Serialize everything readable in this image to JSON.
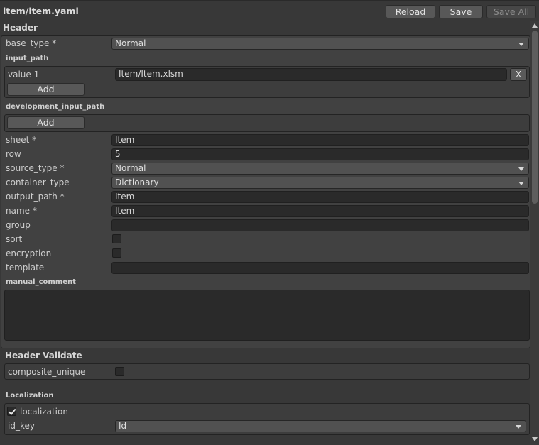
{
  "window": {
    "title": "item/item.yaml"
  },
  "toolbar": {
    "reload_label": "Reload",
    "save_label": "Save",
    "save_all_label": "Save All"
  },
  "header": {
    "title": "Header",
    "base_type": {
      "label": "base_type *",
      "value": "Normal"
    },
    "input_path": {
      "label": "input_path",
      "items": [
        {
          "label": "value 1",
          "value": "Item/Item.xlsm",
          "remove_label": "X"
        }
      ],
      "add_label": "Add"
    },
    "development_input_path": {
      "label": "development_input_path",
      "add_label": "Add"
    },
    "sheet": {
      "label": "sheet *",
      "value": "Item"
    },
    "row": {
      "label": "row",
      "value": "5"
    },
    "source_type": {
      "label": "source_type *",
      "value": "Normal"
    },
    "container_type": {
      "label": "container_type",
      "value": "Dictionary"
    },
    "output_path": {
      "label": "output_path *",
      "value": "Item"
    },
    "name": {
      "label": "name *",
      "value": "Item"
    },
    "group": {
      "label": "group",
      "value": ""
    },
    "sort": {
      "label": "sort",
      "checked": false
    },
    "encryption": {
      "label": "encryption",
      "checked": false
    },
    "template": {
      "label": "template",
      "value": ""
    },
    "manual_comment": {
      "label": "manual_comment",
      "value": ""
    }
  },
  "header_validate": {
    "title": "Header Validate",
    "composite_unique": {
      "label": "composite_unique",
      "checked": false
    }
  },
  "localization": {
    "title": "Localization",
    "localization": {
      "label": "localization",
      "checked": true
    },
    "id_key": {
      "label": "id_key",
      "value": "Id"
    }
  }
}
